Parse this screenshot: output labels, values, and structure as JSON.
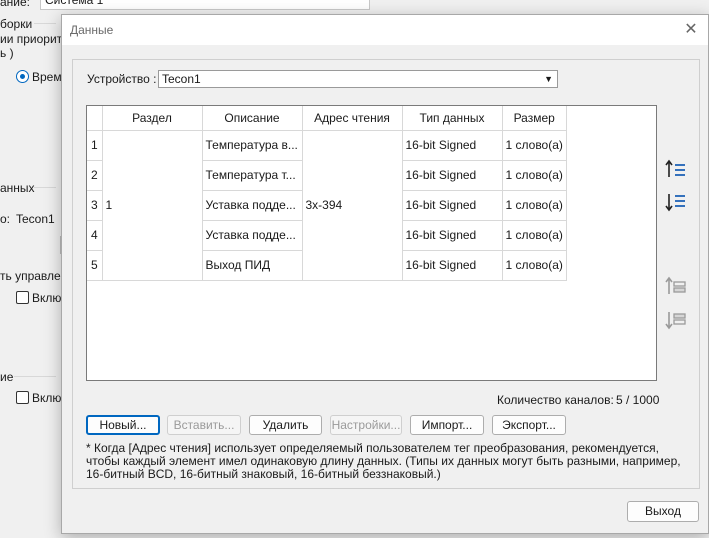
{
  "background": {
    "name_label": "ание:",
    "name_value": "Система 1",
    "text_borki": "борки",
    "text_priority": "ии приорите",
    "text_ch": "ь )",
    "radio_label": "Време",
    "text_dannyh": "анных",
    "text_device": "о:",
    "text_device_value": "Tecon1",
    "text_control": "ть управлен",
    "check1_label": "Включ",
    "text_e": "ие",
    "check2_label": "Включ"
  },
  "dialog": {
    "title": "Данные",
    "close_icon": "close-icon",
    "device_label": "Устройство :",
    "device_value": "Tecon1",
    "columns": [
      "Раздел",
      "Описание",
      "Адрес чтения",
      "Тип данных",
      "Размер"
    ],
    "section_value": "1",
    "address_value": "3x-394",
    "rows": [
      {
        "num": "1",
        "description": "Температура в...",
        "type": "16-bit Signed",
        "size": "1 слово(а)"
      },
      {
        "num": "2",
        "description": "Температура т...",
        "type": "16-bit Signed",
        "size": "1 слово(а)"
      },
      {
        "num": "3",
        "description": "Уставка подде...",
        "type": "16-bit Signed",
        "size": "1 слово(а)"
      },
      {
        "num": "4",
        "description": "Уставка подде...",
        "type": "16-bit Signed",
        "size": "1 слово(а)"
      },
      {
        "num": "5",
        "description": "Выход ПИД",
        "type": "16-bit Signed",
        "size": "1 слово(а)"
      }
    ],
    "count_label": "Количество каналов:",
    "count_value": "5 / 1000",
    "buttons": {
      "new": "Новый...",
      "insert": "Вставить...",
      "delete": "Удалить",
      "settings": "Настройки...",
      "import": "Импорт...",
      "export": "Экспорт..."
    },
    "note": "* Когда [Адрес чтения] использует определяемый пользователем тег преобразования, рекомендуется, чтобы каждый элемент имел одинаковую длину данных. (Типы их данных могут быть разными, например, 16-битный BCD, 16-битный знаковый, 16-битный беззнаковый.)",
    "exit": "Выход"
  },
  "colors": {
    "accent": "#0067c0",
    "icon_blue": "#1a5fb4"
  }
}
